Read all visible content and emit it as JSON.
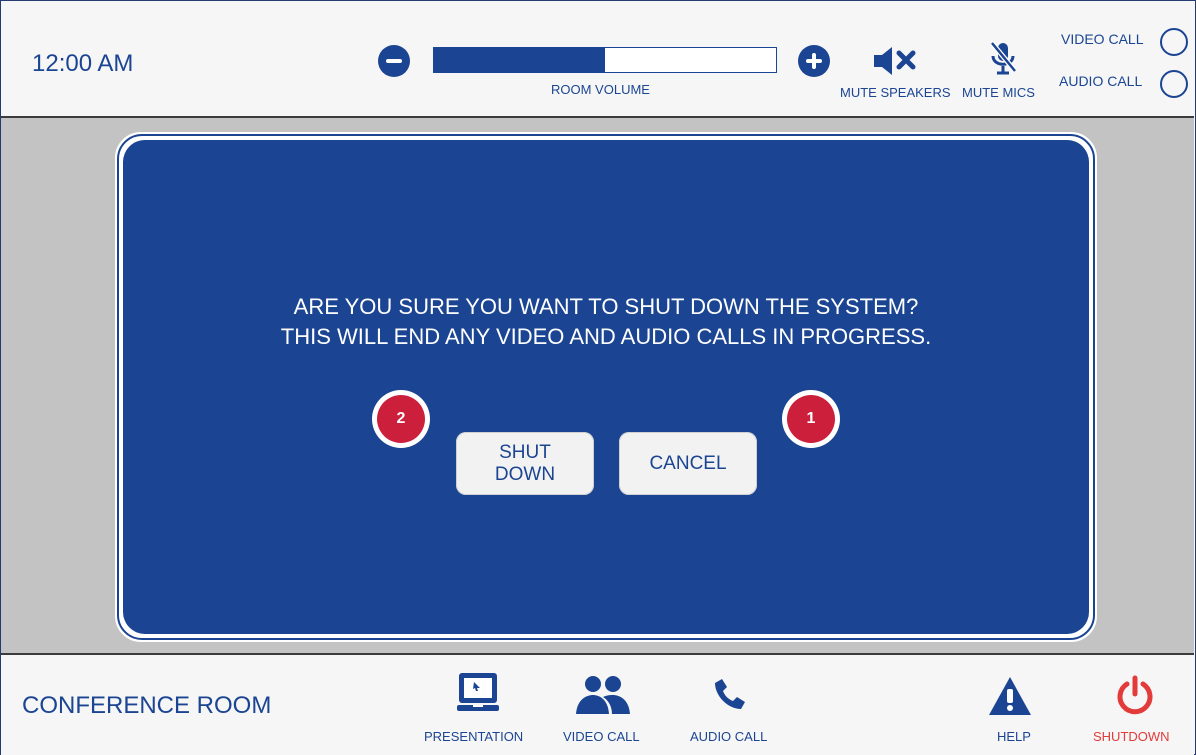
{
  "header": {
    "time": "12:00 AM",
    "volume_label": "ROOM VOLUME",
    "volume_level": 0.5,
    "mute_speakers_label": "MUTE SPEAKERS",
    "mute_mics_label": "MUTE MICS",
    "video_call_label": "VIDEO CALL",
    "audio_call_label": "AUDIO CALL"
  },
  "dialog": {
    "line1": "ARE YOU SURE YOU WANT TO SHUT DOWN THE SYSTEM?",
    "line2": "THIS WILL END ANY VIDEO AND AUDIO CALLS IN PROGRESS.",
    "shutdown_line1": "SHUT",
    "shutdown_line2": "DOWN",
    "cancel_label": "CANCEL",
    "badge_shutdown": "2",
    "badge_cancel": "1"
  },
  "footer": {
    "room_name": "CONFERENCE ROOM",
    "presentation_label": "PRESENTATION",
    "video_call_label": "VIDEO CALL",
    "audio_call_label": "AUDIO CALL",
    "help_label": "HELP",
    "shutdown_label": "SHUTDOWN"
  },
  "colors": {
    "primary": "#1b4593",
    "danger": "#e33a3a",
    "badge": "#cc1f3c"
  },
  "icons": {
    "volume_down": "minus-circle-icon",
    "volume_up": "plus-circle-icon",
    "mute_speakers": "speaker-mute-icon",
    "mute_mics": "mic-off-icon",
    "presentation": "laptop-icon",
    "video_call": "people-icon",
    "audio_call": "phone-icon",
    "help": "warning-icon",
    "shutdown": "power-icon"
  }
}
